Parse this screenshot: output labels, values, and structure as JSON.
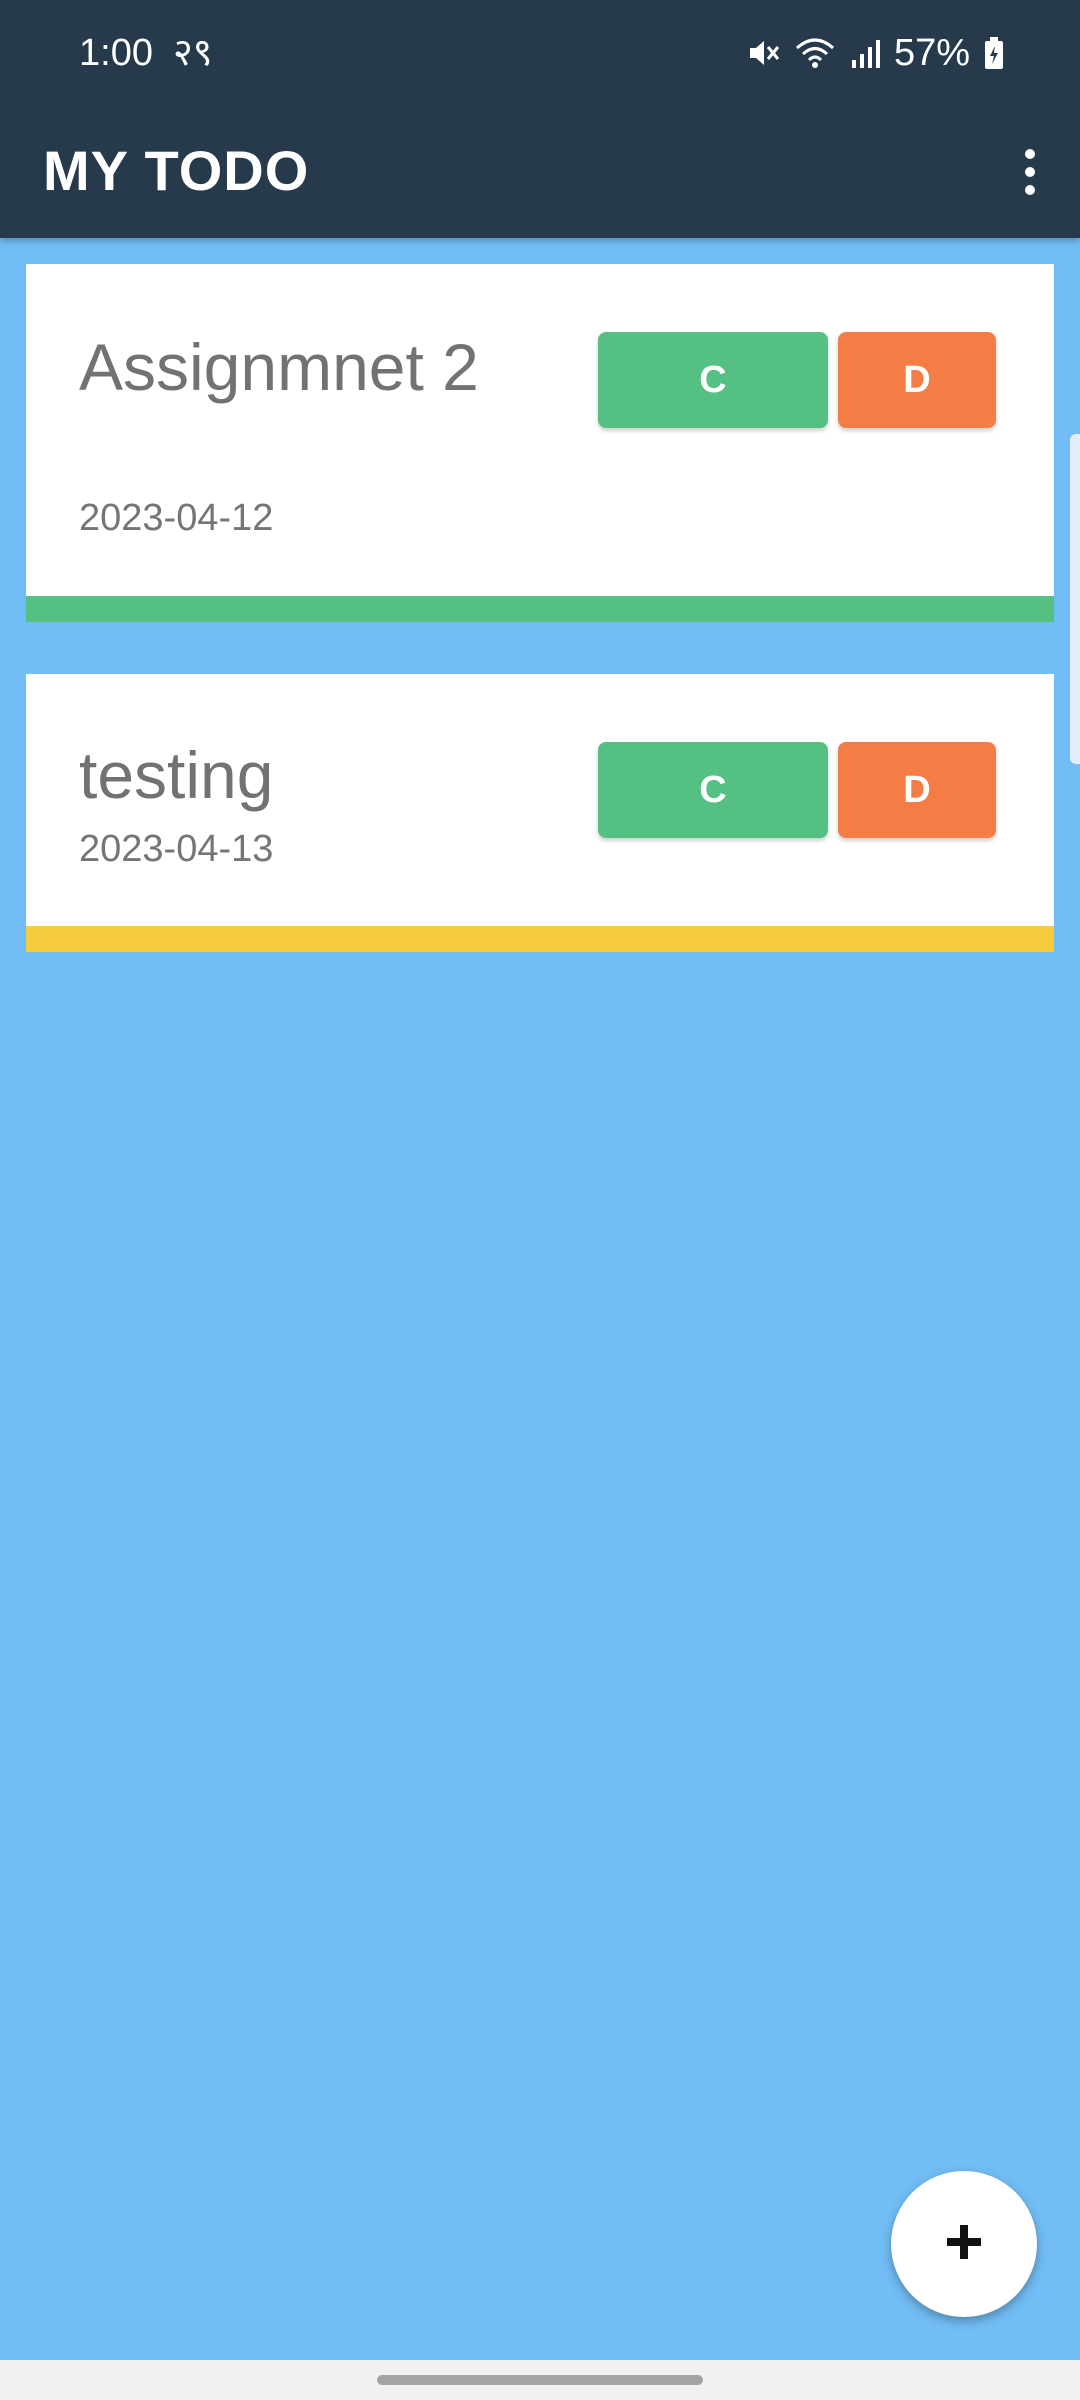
{
  "status_bar": {
    "time": "1:00",
    "extra": "२९",
    "battery": "57%",
    "icons": [
      "mute-icon",
      "wifi-icon",
      "signal-icon",
      "battery-icon"
    ]
  },
  "app_bar": {
    "title": "MY TODO",
    "menu_icon": "more-vert-icon"
  },
  "tasks": [
    {
      "title": "Assignmnet 2",
      "date": "2023-04-12",
      "complete_label": "C",
      "delete_label": "D",
      "stripe_color": "#54c082"
    },
    {
      "title": "testing",
      "date": "2023-04-13",
      "complete_label": "C",
      "delete_label": "D",
      "stripe_color": "#f5cd3c"
    }
  ],
  "fab": {
    "label": "+",
    "icon": "add-icon"
  },
  "colors": {
    "app_bar": "#263a4c",
    "background": "#72bdf5",
    "complete": "#54c082",
    "delete": "#f47d45"
  }
}
